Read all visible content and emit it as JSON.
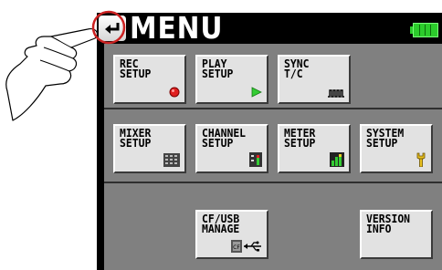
{
  "screen": {
    "title": "MENU"
  },
  "buttons": [
    {
      "id": "rec-setup",
      "label": "REC\nSETUP",
      "icon": "record-dot-icon"
    },
    {
      "id": "play-setup",
      "label": "PLAY\nSETUP",
      "icon": "play-triangle-icon"
    },
    {
      "id": "sync-tc",
      "label": "SYNC\nT/C",
      "icon": "timecode-wave-icon"
    },
    {
      "id": "mixer-setup",
      "label": "MIXER\nSETUP",
      "icon": "mixer-grid-icon"
    },
    {
      "id": "channel-setup",
      "label": "CHANNEL\nSETUP",
      "icon": "channel-meter-icon"
    },
    {
      "id": "meter-setup",
      "label": "METER\nSETUP",
      "icon": "level-meter-icon"
    },
    {
      "id": "system-setup",
      "label": "SYSTEM\nSETUP",
      "icon": "wrench-icon"
    },
    {
      "id": "cf-usb-manage",
      "label": "CF/USB\nMANAGE",
      "icon": "cf-usb-icon"
    },
    {
      "id": "version-info",
      "label": "VERSION\nINFO",
      "icon": ""
    }
  ],
  "colors": {
    "background": "#000000",
    "panel": "#808080",
    "button": "#e2e2e2",
    "battery": "#2ccc2c",
    "record": "#e02020",
    "play": "#33cc33",
    "highlight_circle": "#cc2222"
  }
}
